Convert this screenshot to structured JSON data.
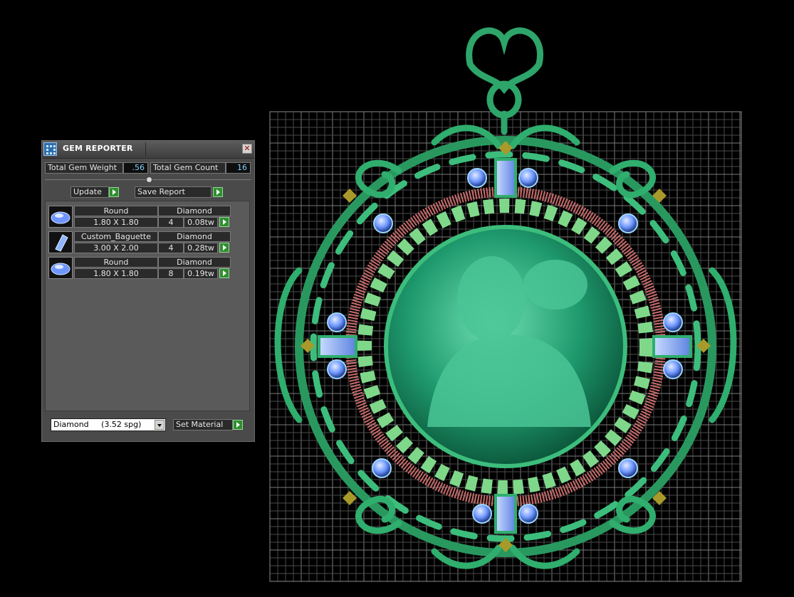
{
  "panel": {
    "title": "GEM REPORTER",
    "total_weight_label": "Total Gem Weight",
    "total_weight_value": ".56",
    "total_count_label": "Total Gem Count",
    "total_count_value": "16",
    "update_label": "Update",
    "save_report_label": "Save Report",
    "gems": [
      {
        "shape": "Round",
        "material": "Diamond",
        "size": "1.80 X 1.80",
        "count": "4",
        "weight": "0.08tw",
        "icon": "round-gem-icon"
      },
      {
        "shape": "Custom_Baguette",
        "material": "Diamond",
        "size": "3.00 X 2.00",
        "count": "4",
        "weight": "0.28tw",
        "icon": "baguette-gem-icon"
      },
      {
        "shape": "Round",
        "material": "Diamond",
        "size": "1.80 X 1.80",
        "count": "8",
        "weight": "0.19tw",
        "icon": "round-gem-icon"
      }
    ],
    "material_select": "Diamond     (3.52 spg)",
    "set_material_label": "Set Material"
  },
  "colors": {
    "metal_green": "#2fae6e",
    "rope_pink": "#c96a6a",
    "gem_blue": "#7fa8ff",
    "accent_value": "#7fd3ff"
  }
}
